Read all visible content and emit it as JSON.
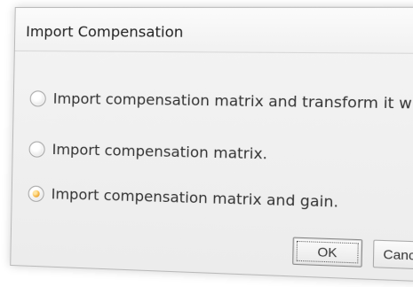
{
  "window": {
    "title": "Import Compensation",
    "close_symbol": "⤭"
  },
  "options": [
    {
      "label": "Import compensation matrix and transform it with current gains."
    },
    {
      "label": "Import compensation matrix."
    },
    {
      "label": "Import compensation matrix and gain."
    }
  ],
  "buttons": {
    "ok": "OK",
    "cancel": "Cancel"
  }
}
